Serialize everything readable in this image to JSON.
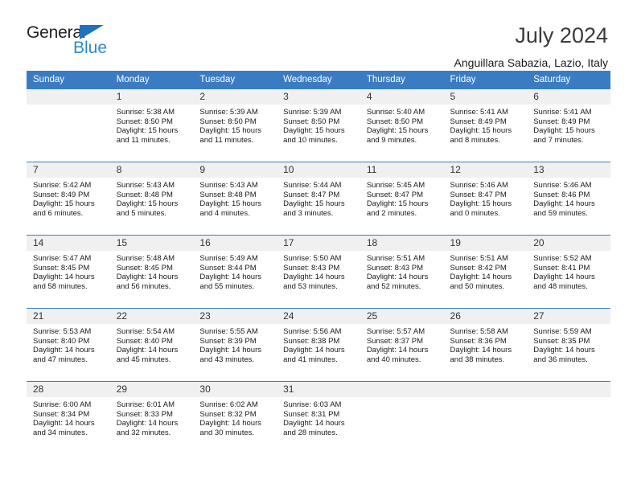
{
  "brand": {
    "name_part1": "General",
    "name_part2": "Blue",
    "accent_color": "#2b8ccc",
    "triangle_color": "#1f72bd"
  },
  "header": {
    "title": "July 2024",
    "subtitle": "Anguillara Sabazia, Lazio, Italy"
  },
  "calendar": {
    "header_bg": "#3a7cc4",
    "daynum_bg": "#f0f0f0",
    "weekday_headers": [
      "Sunday",
      "Monday",
      "Tuesday",
      "Wednesday",
      "Thursday",
      "Friday",
      "Saturday"
    ],
    "weeks": [
      [
        {
          "day": "",
          "sunrise": "",
          "sunset": "",
          "daylight_1": "",
          "daylight_2": ""
        },
        {
          "day": "1",
          "sunrise": "Sunrise: 5:38 AM",
          "sunset": "Sunset: 8:50 PM",
          "daylight_1": "Daylight: 15 hours",
          "daylight_2": "and 11 minutes."
        },
        {
          "day": "2",
          "sunrise": "Sunrise: 5:39 AM",
          "sunset": "Sunset: 8:50 PM",
          "daylight_1": "Daylight: 15 hours",
          "daylight_2": "and 11 minutes."
        },
        {
          "day": "3",
          "sunrise": "Sunrise: 5:39 AM",
          "sunset": "Sunset: 8:50 PM",
          "daylight_1": "Daylight: 15 hours",
          "daylight_2": "and 10 minutes."
        },
        {
          "day": "4",
          "sunrise": "Sunrise: 5:40 AM",
          "sunset": "Sunset: 8:50 PM",
          "daylight_1": "Daylight: 15 hours",
          "daylight_2": "and 9 minutes."
        },
        {
          "day": "5",
          "sunrise": "Sunrise: 5:41 AM",
          "sunset": "Sunset: 8:49 PM",
          "daylight_1": "Daylight: 15 hours",
          "daylight_2": "and 8 minutes."
        },
        {
          "day": "6",
          "sunrise": "Sunrise: 5:41 AM",
          "sunset": "Sunset: 8:49 PM",
          "daylight_1": "Daylight: 15 hours",
          "daylight_2": "and 7 minutes."
        }
      ],
      [
        {
          "day": "7",
          "sunrise": "Sunrise: 5:42 AM",
          "sunset": "Sunset: 8:49 PM",
          "daylight_1": "Daylight: 15 hours",
          "daylight_2": "and 6 minutes."
        },
        {
          "day": "8",
          "sunrise": "Sunrise: 5:43 AM",
          "sunset": "Sunset: 8:48 PM",
          "daylight_1": "Daylight: 15 hours",
          "daylight_2": "and 5 minutes."
        },
        {
          "day": "9",
          "sunrise": "Sunrise: 5:43 AM",
          "sunset": "Sunset: 8:48 PM",
          "daylight_1": "Daylight: 15 hours",
          "daylight_2": "and 4 minutes."
        },
        {
          "day": "10",
          "sunrise": "Sunrise: 5:44 AM",
          "sunset": "Sunset: 8:47 PM",
          "daylight_1": "Daylight: 15 hours",
          "daylight_2": "and 3 minutes."
        },
        {
          "day": "11",
          "sunrise": "Sunrise: 5:45 AM",
          "sunset": "Sunset: 8:47 PM",
          "daylight_1": "Daylight: 15 hours",
          "daylight_2": "and 2 minutes."
        },
        {
          "day": "12",
          "sunrise": "Sunrise: 5:46 AM",
          "sunset": "Sunset: 8:47 PM",
          "daylight_1": "Daylight: 15 hours",
          "daylight_2": "and 0 minutes."
        },
        {
          "day": "13",
          "sunrise": "Sunrise: 5:46 AM",
          "sunset": "Sunset: 8:46 PM",
          "daylight_1": "Daylight: 14 hours",
          "daylight_2": "and 59 minutes."
        }
      ],
      [
        {
          "day": "14",
          "sunrise": "Sunrise: 5:47 AM",
          "sunset": "Sunset: 8:45 PM",
          "daylight_1": "Daylight: 14 hours",
          "daylight_2": "and 58 minutes."
        },
        {
          "day": "15",
          "sunrise": "Sunrise: 5:48 AM",
          "sunset": "Sunset: 8:45 PM",
          "daylight_1": "Daylight: 14 hours",
          "daylight_2": "and 56 minutes."
        },
        {
          "day": "16",
          "sunrise": "Sunrise: 5:49 AM",
          "sunset": "Sunset: 8:44 PM",
          "daylight_1": "Daylight: 14 hours",
          "daylight_2": "and 55 minutes."
        },
        {
          "day": "17",
          "sunrise": "Sunrise: 5:50 AM",
          "sunset": "Sunset: 8:43 PM",
          "daylight_1": "Daylight: 14 hours",
          "daylight_2": "and 53 minutes."
        },
        {
          "day": "18",
          "sunrise": "Sunrise: 5:51 AM",
          "sunset": "Sunset: 8:43 PM",
          "daylight_1": "Daylight: 14 hours",
          "daylight_2": "and 52 minutes."
        },
        {
          "day": "19",
          "sunrise": "Sunrise: 5:51 AM",
          "sunset": "Sunset: 8:42 PM",
          "daylight_1": "Daylight: 14 hours",
          "daylight_2": "and 50 minutes."
        },
        {
          "day": "20",
          "sunrise": "Sunrise: 5:52 AM",
          "sunset": "Sunset: 8:41 PM",
          "daylight_1": "Daylight: 14 hours",
          "daylight_2": "and 48 minutes."
        }
      ],
      [
        {
          "day": "21",
          "sunrise": "Sunrise: 5:53 AM",
          "sunset": "Sunset: 8:40 PM",
          "daylight_1": "Daylight: 14 hours",
          "daylight_2": "and 47 minutes."
        },
        {
          "day": "22",
          "sunrise": "Sunrise: 5:54 AM",
          "sunset": "Sunset: 8:40 PM",
          "daylight_1": "Daylight: 14 hours",
          "daylight_2": "and 45 minutes."
        },
        {
          "day": "23",
          "sunrise": "Sunrise: 5:55 AM",
          "sunset": "Sunset: 8:39 PM",
          "daylight_1": "Daylight: 14 hours",
          "daylight_2": "and 43 minutes."
        },
        {
          "day": "24",
          "sunrise": "Sunrise: 5:56 AM",
          "sunset": "Sunset: 8:38 PM",
          "daylight_1": "Daylight: 14 hours",
          "daylight_2": "and 41 minutes."
        },
        {
          "day": "25",
          "sunrise": "Sunrise: 5:57 AM",
          "sunset": "Sunset: 8:37 PM",
          "daylight_1": "Daylight: 14 hours",
          "daylight_2": "and 40 minutes."
        },
        {
          "day": "26",
          "sunrise": "Sunrise: 5:58 AM",
          "sunset": "Sunset: 8:36 PM",
          "daylight_1": "Daylight: 14 hours",
          "daylight_2": "and 38 minutes."
        },
        {
          "day": "27",
          "sunrise": "Sunrise: 5:59 AM",
          "sunset": "Sunset: 8:35 PM",
          "daylight_1": "Daylight: 14 hours",
          "daylight_2": "and 36 minutes."
        }
      ],
      [
        {
          "day": "28",
          "sunrise": "Sunrise: 6:00 AM",
          "sunset": "Sunset: 8:34 PM",
          "daylight_1": "Daylight: 14 hours",
          "daylight_2": "and 34 minutes."
        },
        {
          "day": "29",
          "sunrise": "Sunrise: 6:01 AM",
          "sunset": "Sunset: 8:33 PM",
          "daylight_1": "Daylight: 14 hours",
          "daylight_2": "and 32 minutes."
        },
        {
          "day": "30",
          "sunrise": "Sunrise: 6:02 AM",
          "sunset": "Sunset: 8:32 PM",
          "daylight_1": "Daylight: 14 hours",
          "daylight_2": "and 30 minutes."
        },
        {
          "day": "31",
          "sunrise": "Sunrise: 6:03 AM",
          "sunset": "Sunset: 8:31 PM",
          "daylight_1": "Daylight: 14 hours",
          "daylight_2": "and 28 minutes."
        },
        {
          "day": "",
          "sunrise": "",
          "sunset": "",
          "daylight_1": "",
          "daylight_2": ""
        },
        {
          "day": "",
          "sunrise": "",
          "sunset": "",
          "daylight_1": "",
          "daylight_2": ""
        },
        {
          "day": "",
          "sunrise": "",
          "sunset": "",
          "daylight_1": "",
          "daylight_2": ""
        }
      ]
    ]
  }
}
